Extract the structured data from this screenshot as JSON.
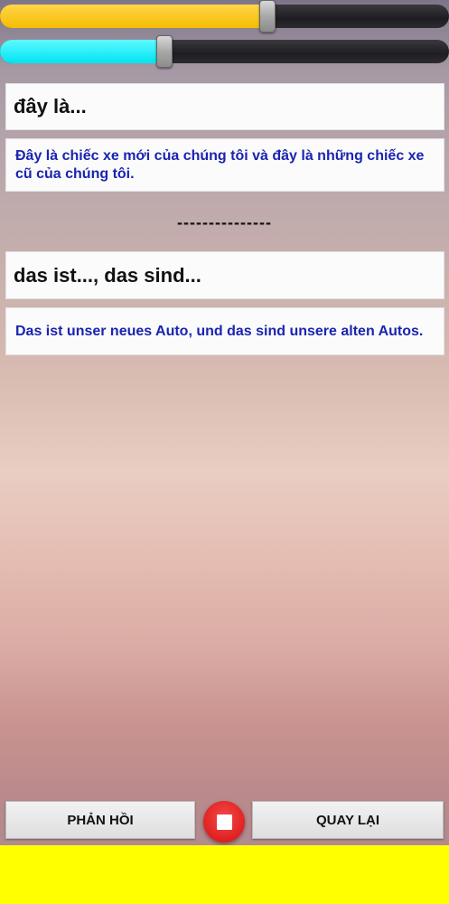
{
  "sliders": {
    "slider1": {
      "color": "#f5bd00",
      "level": 0.6
    },
    "slider2": {
      "color": "#00e4f0",
      "level": 0.37
    }
  },
  "vietnamese": {
    "heading": "đây là...",
    "sentence": "Đây là chiếc xe mới của chúng tôi và đây là những chiếc xe cũ của chúng tôi."
  },
  "divider": "---------------",
  "german": {
    "heading": "das ist..., das sind...",
    "sentence": "Das ist unser neues Auto, und das sind unsere alten Autos."
  },
  "controls": {
    "feedback_label": "PHẢN HỒI",
    "back_label": "QUAY LẠI",
    "stop_icon": "stop-icon",
    "stop_color": "#e02020"
  },
  "banner": {
    "color": "#ffff00"
  }
}
